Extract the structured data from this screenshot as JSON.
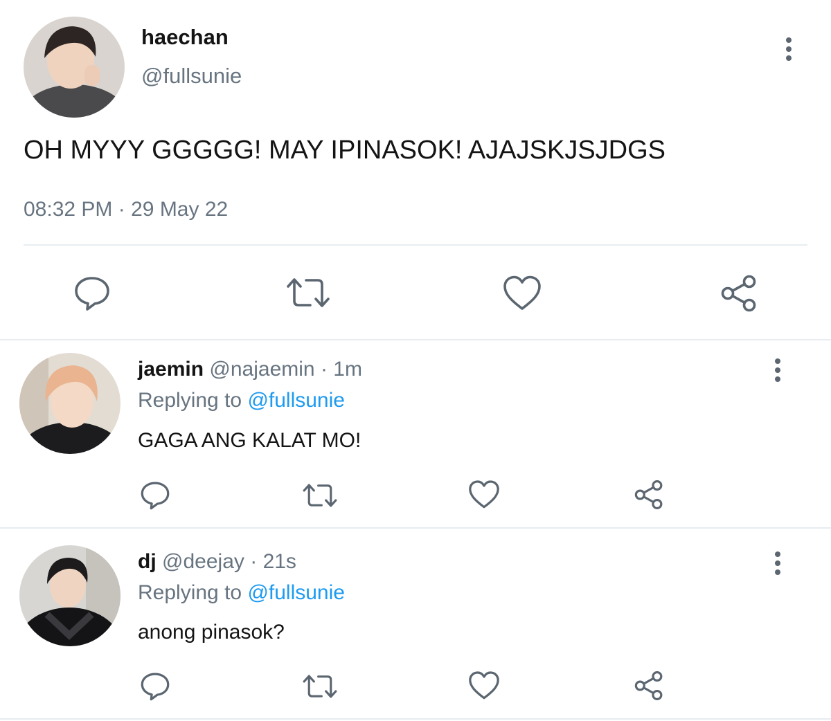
{
  "main_tweet": {
    "display_name": "haechan",
    "handle": "@fullsunie",
    "text": "OH MYYY GGGGG! MAY IPINASOK! AJAJSKJSJDGS",
    "time": "08:32 PM",
    "separator": "·",
    "date": "29 May 22"
  },
  "replies": [
    {
      "display_name": "jaemin",
      "handle": "@najaemin",
      "separator": "·",
      "time": "1m",
      "replying_prefix": "Replying to",
      "replying_handle": "@fullsunie",
      "text": "GAGA ANG KALAT MO!"
    },
    {
      "display_name": "dj",
      "handle": "@deejay",
      "separator": "·",
      "time": "21s",
      "replying_prefix": "Replying to",
      "replying_handle": "@fullsunie",
      "text": "anong pinasok?"
    }
  ],
  "icons": [
    "reply-icon",
    "retweet-icon",
    "like-icon",
    "share-icon",
    "more-icon"
  ],
  "colors": {
    "icon": "#5b6670",
    "link": "#1d9bf0",
    "muted": "#677480",
    "text": "#141414",
    "divider": "#e6ecf0"
  }
}
